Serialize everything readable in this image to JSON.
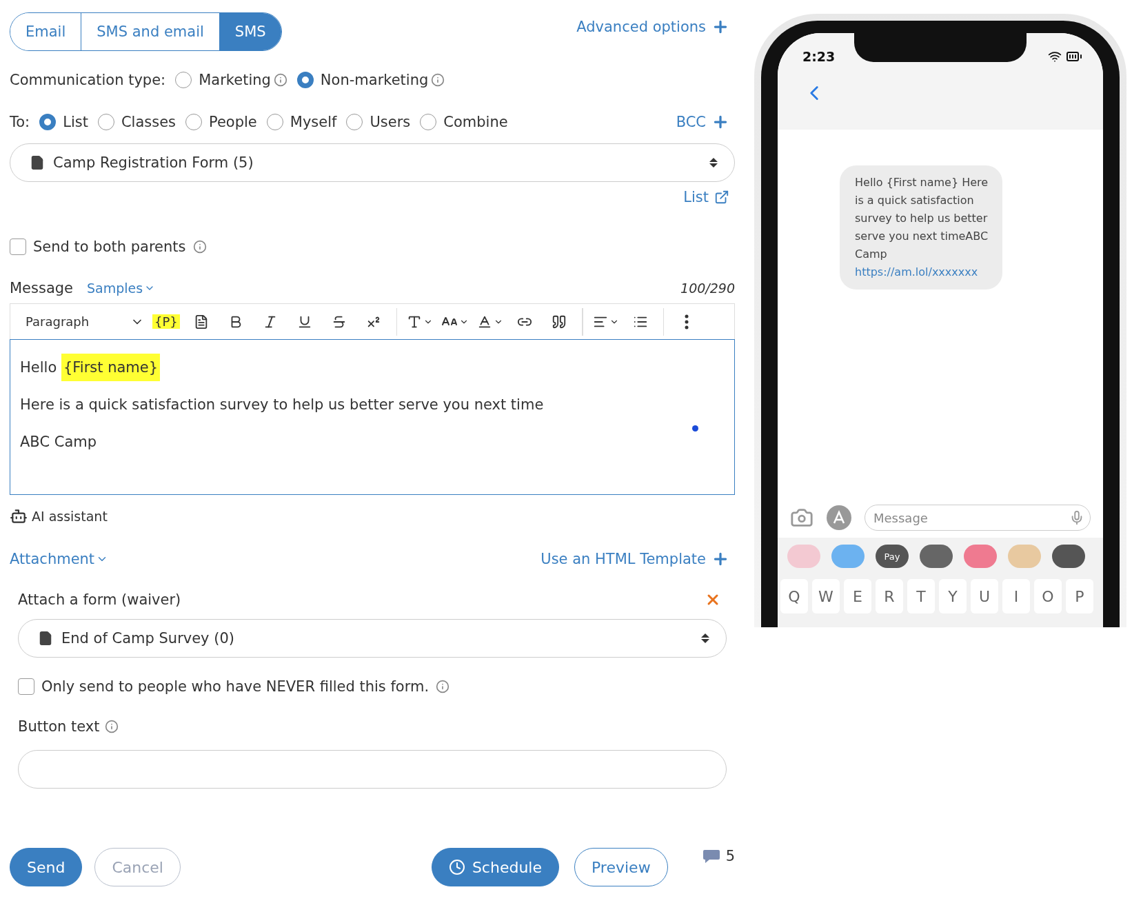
{
  "channel_tabs": [
    {
      "label": "Email",
      "selected": false
    },
    {
      "label": "SMS and email",
      "selected": false
    },
    {
      "label": "SMS",
      "selected": true
    }
  ],
  "advanced_options": "Advanced options",
  "communication_type": {
    "label": "Communication type:",
    "options": [
      {
        "label": "Marketing",
        "selected": false
      },
      {
        "label": "Non-marketing",
        "selected": true
      }
    ]
  },
  "to": {
    "label": "To:",
    "options": [
      {
        "label": "List",
        "selected": true
      },
      {
        "label": "Classes",
        "selected": false
      },
      {
        "label": "People",
        "selected": false
      },
      {
        "label": "Myself",
        "selected": false
      },
      {
        "label": "Users",
        "selected": false
      },
      {
        "label": "Combine",
        "selected": false
      }
    ],
    "bcc": "BCC"
  },
  "list_select": {
    "value": "Camp Registration Form (5)"
  },
  "list_link": "List",
  "send_to_both_parents": {
    "label": "Send to both parents",
    "checked": false
  },
  "message": {
    "label": "Message",
    "samples": "Samples",
    "counter": "100/290",
    "toolbar": [
      {
        "kind": "block",
        "label": "Paragraph"
      },
      {
        "kind": "placeholder",
        "label": "{P}"
      },
      {
        "kind": "document"
      },
      {
        "kind": "bold"
      },
      {
        "kind": "italic"
      },
      {
        "kind": "underline"
      },
      {
        "kind": "strike"
      },
      {
        "kind": "superscript"
      },
      {
        "kind": "divider"
      },
      {
        "kind": "font-family"
      },
      {
        "kind": "font-size"
      },
      {
        "kind": "font-color"
      },
      {
        "kind": "link"
      },
      {
        "kind": "quote"
      },
      {
        "kind": "divider"
      },
      {
        "kind": "align"
      },
      {
        "kind": "bullets"
      },
      {
        "kind": "divider"
      },
      {
        "kind": "more"
      }
    ],
    "greeting": "Hello",
    "merge_field": "{First name}",
    "body": "Here is a quick satisfaction survey to help us better serve you next time",
    "signature": "ABC Camp"
  },
  "ai_assistant": "AI assistant",
  "attachment": "Attachment",
  "html_template": "Use an HTML Template",
  "attach_form": {
    "title": "Attach a form (waiver)",
    "value": "End of Camp Survey (0)",
    "never_filled": {
      "label": "Only send to people who have NEVER filled this form.",
      "checked": false
    },
    "button_text_label": "Button text"
  },
  "actions": {
    "send": "Send",
    "cancel": "Cancel",
    "schedule": "Schedule",
    "preview": "Preview",
    "sms_count": "5"
  },
  "phone": {
    "time": "2:23",
    "bubble": "Hello {First name} Here is a quick satisfaction survey to help us better serve you next timeABC Camp",
    "bubble_link": "https://am.lol/xxxxxxx",
    "placeholder": "Message",
    "apps": [
      {
        "kind": "photos"
      },
      {
        "kind": "store"
      },
      {
        "kind": "pay",
        "label": "Pay"
      },
      {
        "kind": "activity"
      },
      {
        "kind": "search"
      },
      {
        "kind": "monkey"
      },
      {
        "kind": "heart"
      }
    ],
    "keys": [
      "Q",
      "W",
      "E",
      "R",
      "T",
      "Y",
      "U",
      "I",
      "O",
      "P"
    ]
  }
}
